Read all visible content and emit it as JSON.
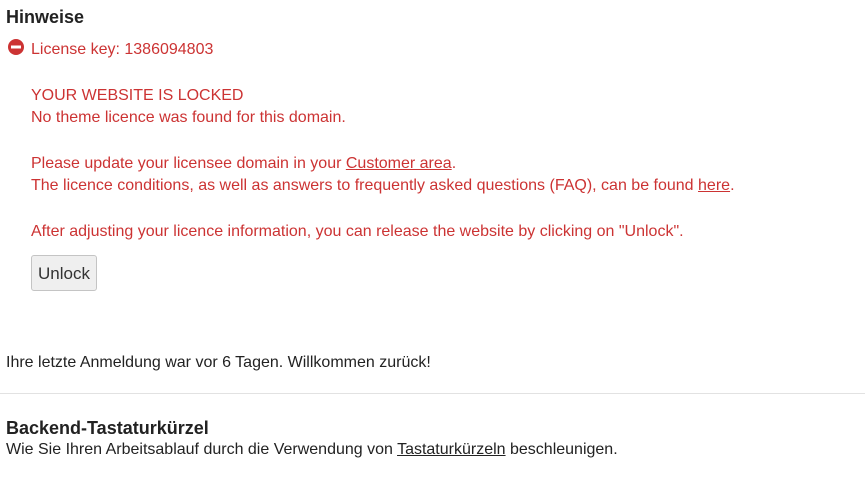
{
  "section_title": "Hinweise",
  "notice": {
    "license_line": "License key: 1386094803",
    "locked_title": "YOUR WEBSITE IS LOCKED",
    "no_licence": "No theme licence was found for this domain.",
    "update_prefix": "Please update your licensee domain in your ",
    "customer_area_link": "Customer area",
    "update_suffix": ".",
    "conditions_prefix": "The licence conditions, as well as answers to frequently asked questions (FAQ), can be found ",
    "here_link": "here",
    "conditions_suffix": ".",
    "after_adjusting": "After adjusting your licence information, you can release the website by clicking on \"Unlock\".",
    "unlock_label": "Unlock",
    "color": "#cc3333"
  },
  "last_login": "Ihre letzte Anmeldung war vor 6 Tagen. Willkommen zurück!",
  "shortcuts": {
    "title": "Backend-Tastaturkürzel",
    "text_prefix": "Wie Sie Ihren Arbeitsablauf durch die Verwendung von ",
    "link": "Tastaturkürzeln",
    "text_suffix": " beschleunigen."
  }
}
